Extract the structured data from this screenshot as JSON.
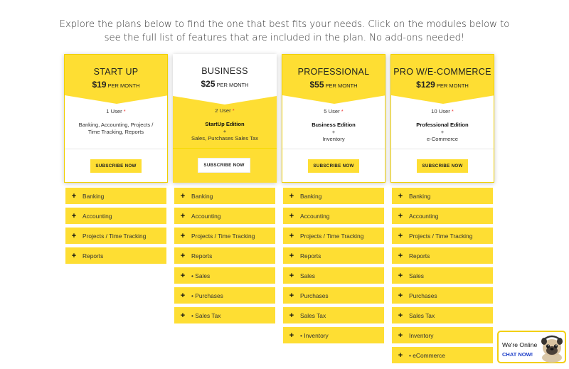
{
  "intro": "Explore the plans below to find the one that best fits your needs. Click on the modules below to see the full list of features that are included in the plan. No add-ons needed!",
  "colors": {
    "accent": "#fede33",
    "border": "#f0d000",
    "chat_link": "#1a3cc8"
  },
  "plans": [
    {
      "name": "START UP",
      "price": "$19",
      "per": "PER MONTH",
      "users": "1 User",
      "star": "*",
      "features_bold": "",
      "features_plus": "",
      "features": "Banking, Accounting, Projects / Time Tracking, Reports",
      "subscribe": "SUBSCRIBE NOW",
      "modules": [
        "Banking",
        "Accounting",
        "Projects / Time Tracking",
        "Reports"
      ]
    },
    {
      "name": "BUSINESS",
      "price": "$25",
      "per": "PER MONTH",
      "users": "2 User",
      "star": "*",
      "features_bold": "StartUp Edition",
      "features_plus": "+",
      "features": "Sales, Purchases Sales Tax",
      "subscribe": "SUBSCRIBE NOW",
      "modules": [
        "Banking",
        "Accounting",
        "Projects / Time Tracking",
        "Reports",
        "• Sales",
        "• Purchases",
        "• Sales Tax"
      ]
    },
    {
      "name": "PROFESSIONAL",
      "price": "$55",
      "per": "PER MONTH",
      "users": "5 User",
      "star": "*",
      "features_bold": "Business Edition",
      "features_plus": "+",
      "features": "Inventory",
      "subscribe": "SUBSCRIBE NOW",
      "modules": [
        "Banking",
        "Accounting",
        "Projects / Time Tracking",
        "Reports",
        "Sales",
        "Purchases",
        "Sales Tax",
        "• Inventory"
      ]
    },
    {
      "name": "PRO W/E-COMMERCE",
      "price": "$129",
      "per": "PER MONTH",
      "users": "10 User",
      "star": "*",
      "features_bold": "Professional Edition",
      "features_plus": "+",
      "features": "e-Commerce",
      "subscribe": "SUBSCRIBE NOW",
      "modules": [
        "Banking",
        "Accounting",
        "Projects / Time Tracking",
        "Reports",
        "Sales",
        "Purchases",
        "Sales Tax",
        "Inventory",
        "• eCommerce"
      ]
    }
  ],
  "module_icon": "plus-icon",
  "chat": {
    "status": "We're Online",
    "action": "CHAT NOW!",
    "icon": "pug-mascot-icon"
  }
}
